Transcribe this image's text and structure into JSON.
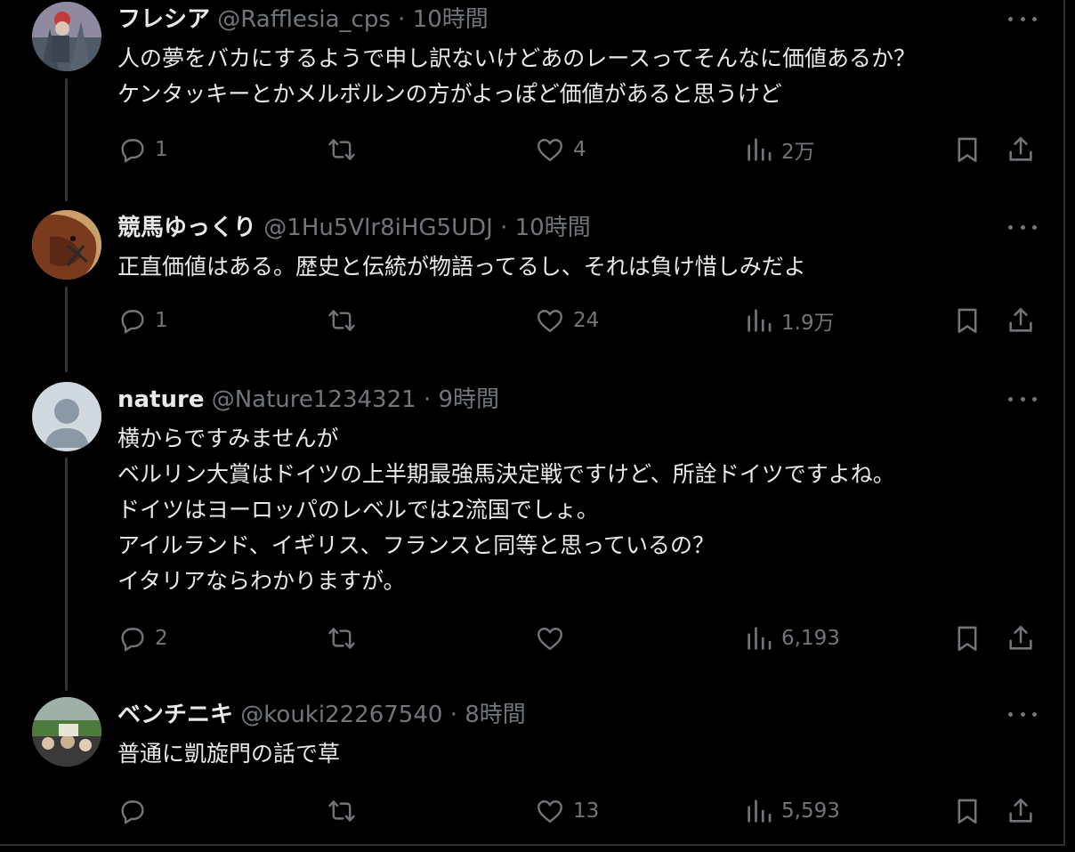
{
  "tweets": [
    {
      "name": "フレシア",
      "handle": "@Rafflesia_cps",
      "time": "10時間",
      "lines": [
        "人の夢をバカにするようで申し訳ないけどあのレースってそんなに価値あるか？",
        "ケンタッキーとかメルボルンの方がよっぽど価値があると思うけど"
      ],
      "replies": "1",
      "retweets": "",
      "likes": "4",
      "views": "2万"
    },
    {
      "name": "競馬ゆっくり",
      "handle": "@1Hu5Vlr8iHG5UDJ",
      "time": "10時間",
      "lines": [
        "正直価値はある。歴史と伝統が物語ってるし、それは負け惜しみだよ"
      ],
      "replies": "1",
      "retweets": "",
      "likes": "24",
      "views": "1.9万"
    },
    {
      "name": "nature",
      "handle": "@Nature1234321",
      "time": "9時間",
      "lines": [
        "横からですみませんが",
        "ベルリン大賞はドイツの上半期最強馬決定戦ですけど、所詮ドイツですよね。",
        "ドイツはヨーロッパのレベルでは2流国でしょ。",
        "アイルランド、イギリス、フランスと同等と思っているの？",
        "イタリアならわかりますが。"
      ],
      "replies": "2",
      "retweets": "",
      "likes": "",
      "views": "6,193"
    },
    {
      "name": "ベンチニキ",
      "handle": "@kouki22267540",
      "time": "8時間",
      "lines": [
        "普通に凱旋門の話で草"
      ],
      "replies": "",
      "retweets": "",
      "likes": "13",
      "views": "5,593"
    }
  ],
  "separator": "·",
  "icons": {
    "reply": "reply-icon",
    "retweet": "retweet-icon",
    "like": "heart-icon",
    "views": "views-chart-icon",
    "bookmark": "bookmark-icon",
    "share": "share-icon",
    "more": "more-icon"
  },
  "colors": {
    "background": "#000000",
    "text": "#e7e9ea",
    "muted": "#71767b",
    "thread_line": "#333639"
  }
}
